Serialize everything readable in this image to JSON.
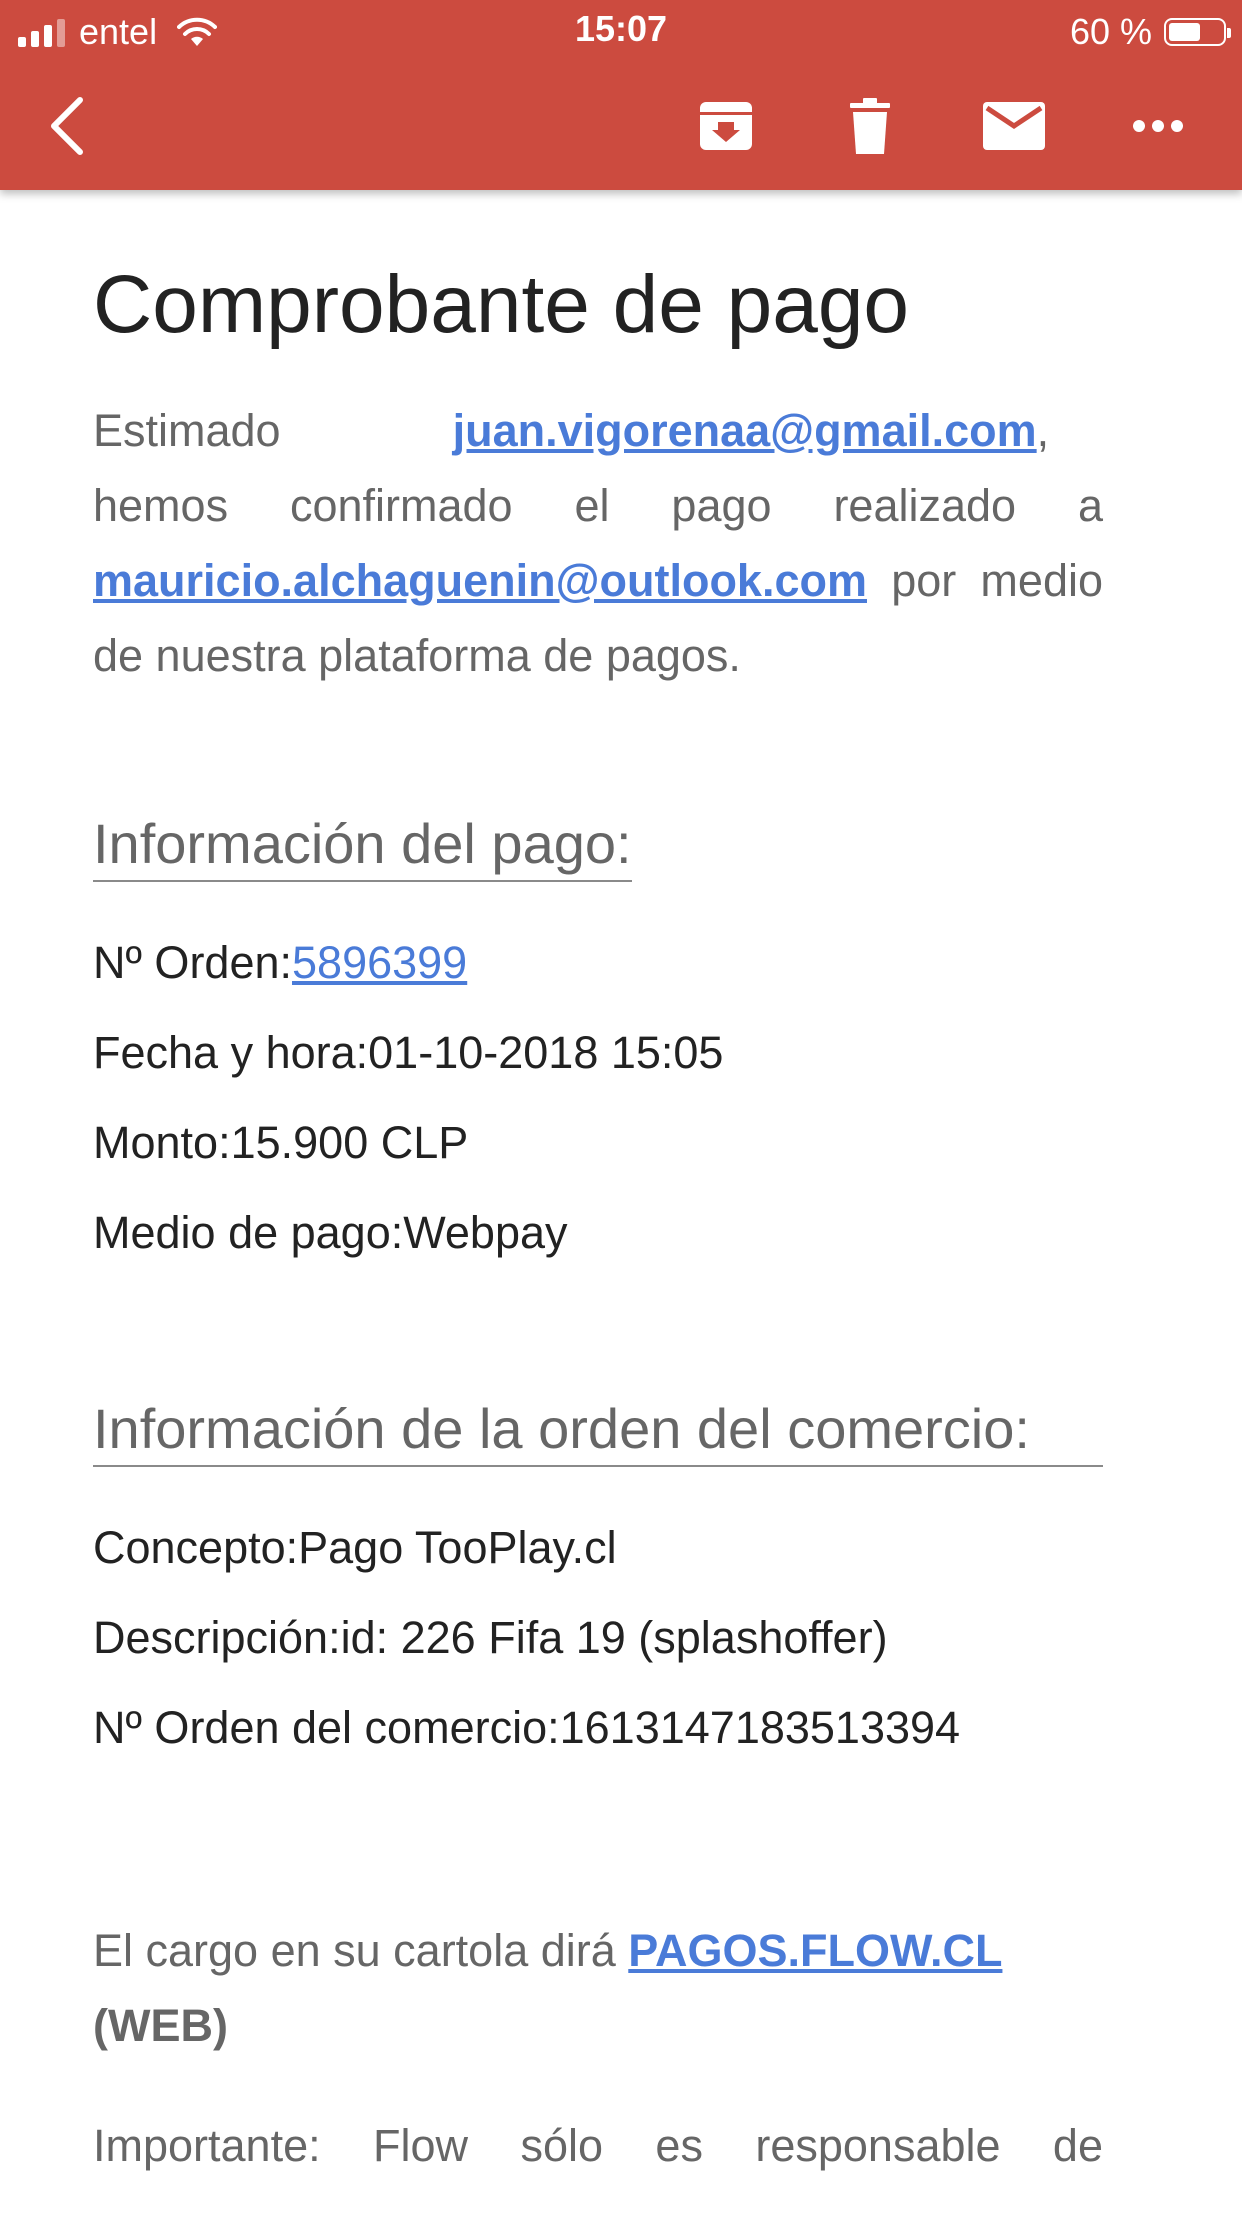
{
  "status_bar": {
    "carrier": "entel",
    "time": "15:07",
    "battery_text": "60 %",
    "battery_level": 0.6
  },
  "toolbar": {
    "icons": [
      "back-arrow-icon",
      "archive-icon",
      "trash-icon",
      "mail-icon",
      "more-icon"
    ],
    "color": "#cc4b3f"
  },
  "email": {
    "title": "Comprobante de pago",
    "intro": {
      "greeting": "Estimado",
      "payer_email": "juan.vigorenaa@gmail.com",
      "after_payer": ", hemos confirmado el pago realizado a ",
      "merchant_email": "mauricio.alchaguenin@outlook.com",
      "after_merchant": " por medio de nuestra plataforma de pagos."
    },
    "payment_info": {
      "heading": "Información del pago:",
      "order_label": "Nº Orden:",
      "order_value": "5896399",
      "date_label": "Fecha y hora:",
      "date_value": "01-10-2018 15:05",
      "amount_label": "Monto:",
      "amount_value": "15.900 CLP",
      "method_label": "Medio de pago:",
      "method_value": "Webpay"
    },
    "merchant_order": {
      "heading": "Información de la orden del comercio:",
      "concept_label": "Concepto:",
      "concept_value": "Pago TooPlay.cl",
      "description_label": "Descripción:",
      "description_value": "id: 226 Fifa 19 (splashoffer)",
      "merchant_order_label": "Nº Orden del comercio:",
      "merchant_order_value": "1613147183513394"
    },
    "statement": {
      "prefix": "El cargo en su cartola dirá ",
      "link": "PAGOS.FLOW.CL",
      "suffix": "(WEB)"
    },
    "important": "Importante: Flow sólo es responsable de"
  },
  "colors": {
    "header": "#cc4b3f",
    "link": "#4a7bd8"
  }
}
